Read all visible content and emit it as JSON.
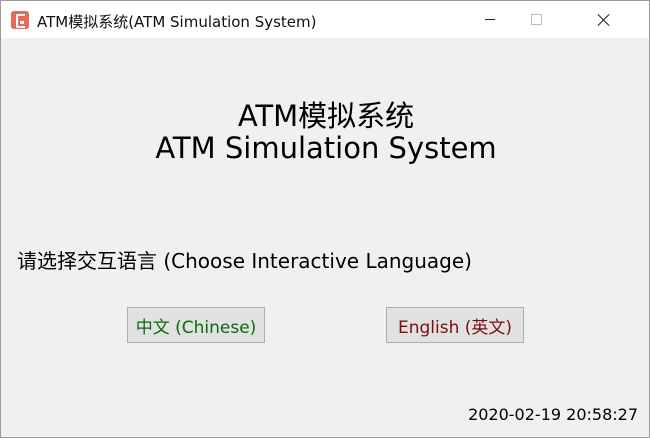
{
  "window": {
    "title": "ATM模拟系统(ATM Simulation System)"
  },
  "main": {
    "heading_cn": "ATM模拟系统",
    "heading_en": "ATM Simulation System",
    "prompt": "请选择交互语言 (Choose Interactive Language)",
    "chinese_button": "中文 (Chinese)",
    "english_button": "English (英文)",
    "timestamp": "2020-02-19 20:58:27"
  },
  "colors": {
    "chinese_button_text": "#0b6b0b",
    "english_button_text": "#7a0e0e",
    "app_icon": "#e46b5b"
  },
  "icons": [
    "app-icon",
    "minimize-icon",
    "maximize-icon",
    "close-icon"
  ]
}
